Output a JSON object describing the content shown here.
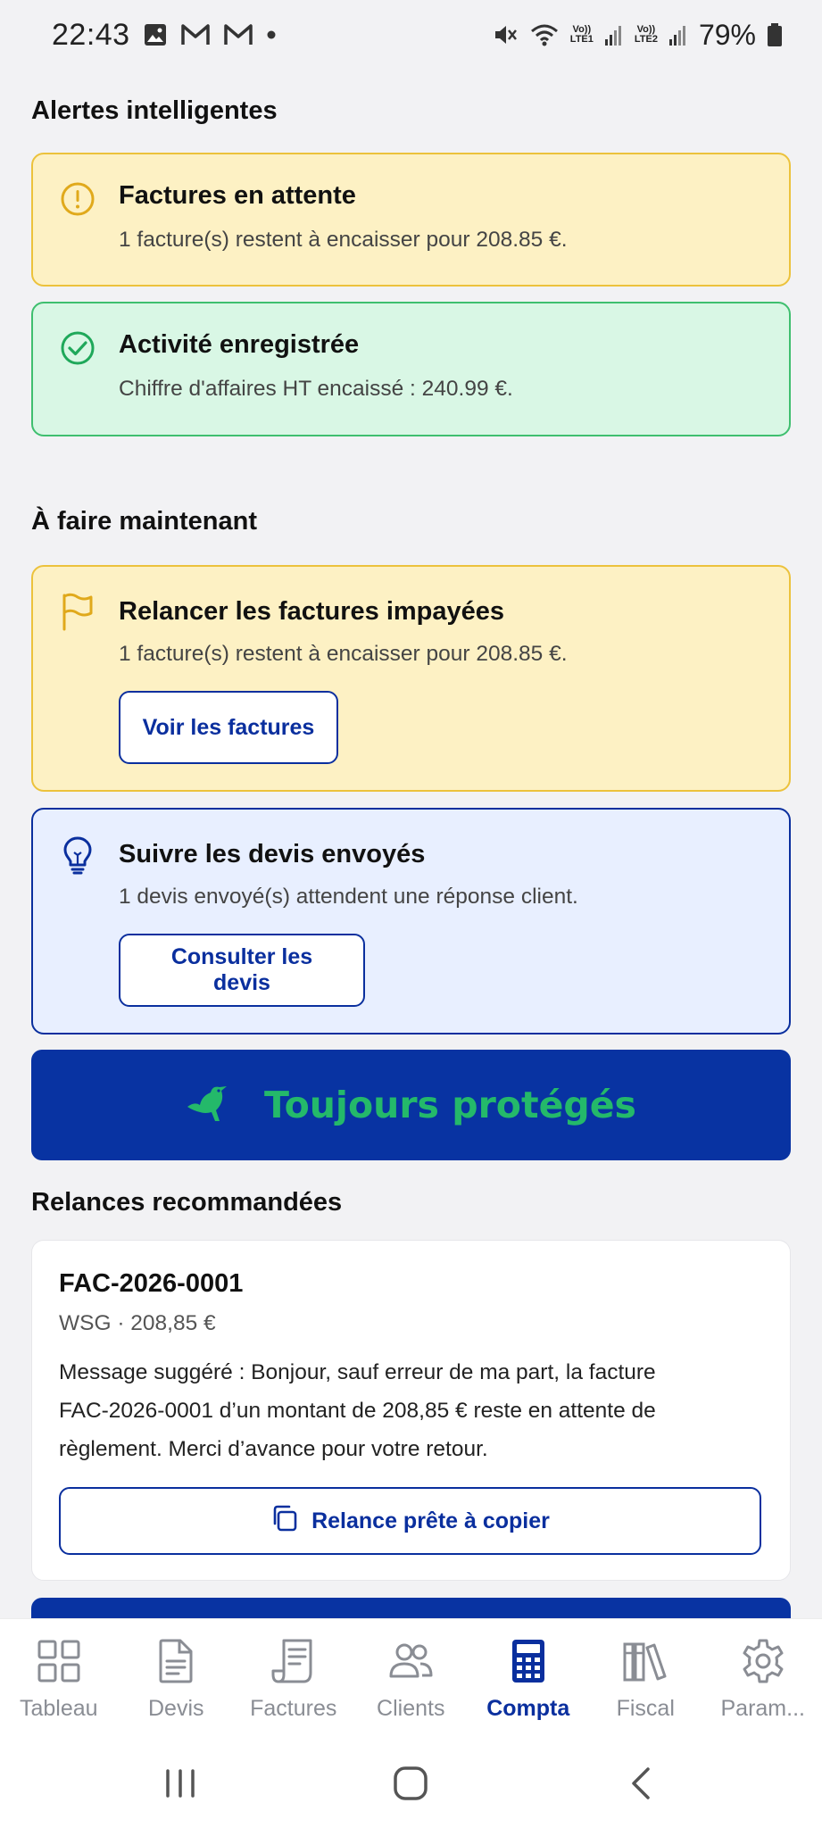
{
  "status_bar": {
    "time": "22:43",
    "battery": "79%",
    "sim1": "LTE1",
    "sim2": "LTE2",
    "volte": "Vo))"
  },
  "alerts": {
    "title": "Alertes intelligentes",
    "items": [
      {
        "title": "Factures en attente",
        "text": "1 facture(s) restent à encaisser pour 208.85 €.",
        "icon": "warning-circle-icon"
      },
      {
        "title": "Activité enregistrée",
        "text": "Chiffre d'affaires HT encaissé : 240.99 €.",
        "icon": "check-circle-icon"
      }
    ]
  },
  "todo": {
    "title": "À faire maintenant",
    "items": [
      {
        "title": "Relancer les factures impayées",
        "text": "1 facture(s) restent à encaisser pour 208.85 €.",
        "button": "Voir les factures",
        "icon": "flag-icon"
      },
      {
        "title": "Suivre les devis envoyés",
        "text": "1 devis envoyé(s) attendent une réponse client.",
        "button": "Consulter les devis",
        "icon": "lightbulb-icon"
      }
    ]
  },
  "banner": {
    "text": "Toujours protégés",
    "icon": "bird-icon"
  },
  "reminders": {
    "title": "Relances recommandées",
    "items": [
      {
        "invoice": "FAC-2026-0001",
        "meta": "WSG · 208,85 €",
        "message_lines": [
          "Message suggéré : Bonjour, sauf erreur de ma part, la facture",
          "FAC-2026-0001 d’un montant de 208,85 € reste en attente de",
          "règlement. Merci d’avance pour votre retour."
        ],
        "button": "Relance prête à copier"
      }
    ]
  },
  "bottom_nav": [
    {
      "label": "Tableau",
      "icon": "grid-icon"
    },
    {
      "label": "Devis",
      "icon": "document-icon"
    },
    {
      "label": "Factures",
      "icon": "receipt-icon"
    },
    {
      "label": "Clients",
      "icon": "users-icon"
    },
    {
      "label": "Compta",
      "icon": "calculator-icon",
      "active": true
    },
    {
      "label": "Fiscal",
      "icon": "library-icon"
    },
    {
      "label": "Param...",
      "icon": "gear-icon"
    }
  ],
  "colors": {
    "primary": "#0a2f9e",
    "banner_text": "#24b96a",
    "warning_bg": "#fdf1c4",
    "warning_border": "#ecc23c",
    "success_bg": "#d9f7e5",
    "success_border": "#3fbf6f",
    "info_bg": "#e8efff"
  }
}
